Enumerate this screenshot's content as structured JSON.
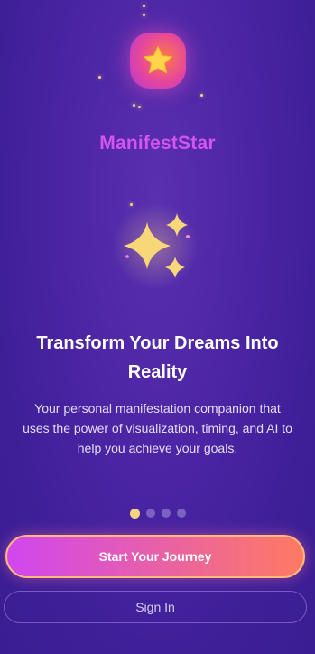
{
  "app": {
    "brand_name": "ManifestStar",
    "logo_icon": "star-icon",
    "hero_icon": "sparkles-icon"
  },
  "onboarding": {
    "headline": "Transform Your Dreams Into Reality",
    "description": "Your personal manifestation companion that uses the power of visualization, timing, and AI to help you achieve your goals.",
    "pages_total": 4,
    "current_page": 1
  },
  "actions": {
    "primary_label": "Start Your Journey",
    "secondary_label": "Sign In"
  },
  "colors": {
    "background": "#4a24a3",
    "brand_text": "#d454f0",
    "accent_gold": "#f6d37c",
    "button_gradient_start": "#d046f0",
    "button_gradient_end": "#ff7a62"
  }
}
